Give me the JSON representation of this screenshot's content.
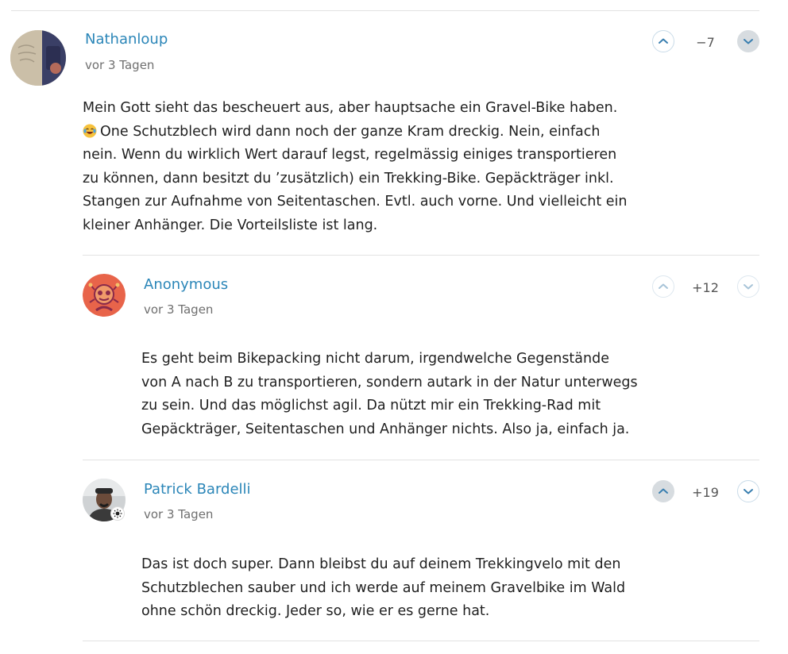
{
  "comments": [
    {
      "username": "Nathanloup",
      "time": "vor 3 Tagen",
      "score": "−7",
      "avatar": "nathanloup-avatar",
      "lines": [
        "Mein Gott sieht das bescheuert aus, aber hauptsache ein Gravel-Bike haben.",
        "One Schutzblech wird dann noch der ganze Kram dreckig. Nein, einfach",
        "nein. Wenn du wirklich Wert darauf legst, regelmässig einiges transportieren",
        "zu können, dann besitzt du ʼzusätzlich) ein Trekking-Bike. Gepäckträger inkl.",
        "Stangen zur Aufnahme von Seitentaschen. Evtl. auch vorne. Und vielleicht ein",
        "kleiner Anhänger. Die Vorteilsliste ist lang."
      ],
      "emoji_icon": "laughing-crying-emoji"
    },
    {
      "username": "Anonymous",
      "time": "vor 3 Tagen",
      "score": "+12",
      "avatar": "anonymous-avatar",
      "lines": [
        "Es geht beim Bikepacking nicht darum, irgendwelche Gegenstände",
        "von A nach B zu transportieren, sondern autark in der Natur unterwegs",
        "zu sein. Und das möglichst agil. Da nützt mir ein Trekking-Rad mit",
        "Gepäckträger, Seitentaschen und Anhänger nichts. Also ja, einfach ja."
      ]
    },
    {
      "username": "Patrick Bardelli",
      "time": "vor 3 Tagen",
      "score": "+19",
      "avatar": "patrick-bardelli-avatar",
      "badge_icon": "sun-badge-icon",
      "lines": [
        "Das ist doch super. Dann bleibst du auf deinem Trekkingvelo mit den",
        "Schutzblechen sauber und ich werde auf meinem Gravelbike im Wald",
        "ohne schön dreckig. Jeder so, wie er es gerne hat."
      ]
    }
  ],
  "icons": {
    "upvote": "chevron-up-icon",
    "downvote": "chevron-down-icon"
  },
  "colors": {
    "username": "#2b86b8",
    "divider": "#e2e2e2",
    "vote_active_bg": "#d7dce0",
    "anonymous_avatar_bg": "#e8644a"
  }
}
